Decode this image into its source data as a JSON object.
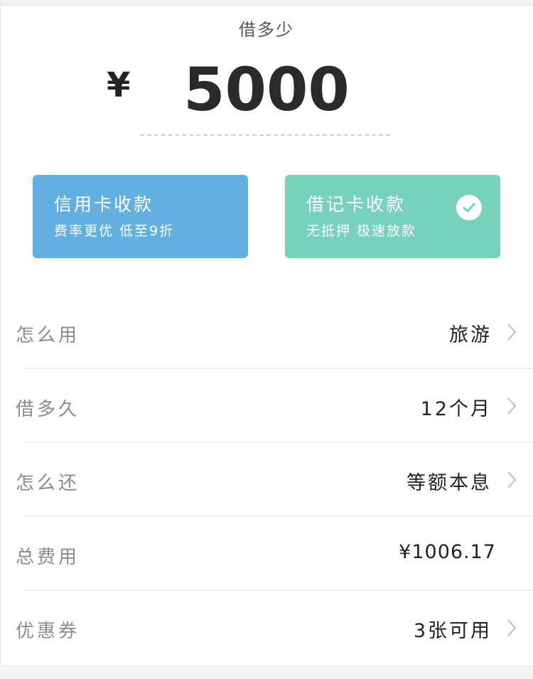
{
  "header": {
    "title": "借多少"
  },
  "amount": {
    "currency": "¥",
    "value": "5000"
  },
  "options": [
    {
      "title": "信用卡收款",
      "subtitle": "费率更优 低至9折",
      "color": "#62b0e0",
      "selected": false
    },
    {
      "title": "借记卡收款",
      "subtitle": "无抵押 极速放款",
      "color": "#76d2bb",
      "selected": true
    }
  ],
  "rows": [
    {
      "label": "怎么用",
      "value": "旅游",
      "chevron": true
    },
    {
      "label": "借多久",
      "value": "12个月",
      "chevron": true
    },
    {
      "label": "怎么还",
      "value": "等额本息",
      "chevron": true
    },
    {
      "label": "总费用",
      "value": "¥1006.17",
      "chevron": false
    },
    {
      "label": "优惠券",
      "value": "3张可用",
      "chevron": true
    }
  ],
  "icons": {
    "selected": "check-circle-icon",
    "row_arrow": "chevron-right-icon"
  }
}
